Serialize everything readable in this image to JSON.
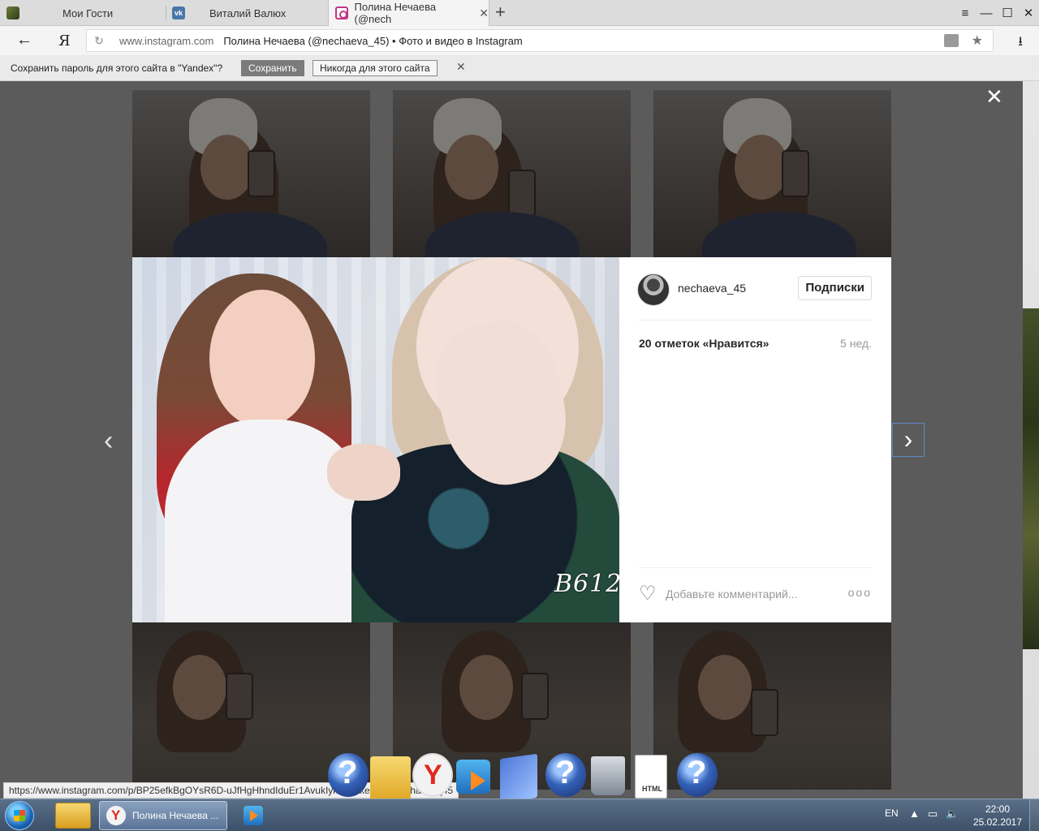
{
  "tabs": [
    {
      "label": "Мои Гости",
      "favicon": "apps-icon"
    },
    {
      "label": "Виталий Валюх",
      "favicon": "vk-icon"
    },
    {
      "label": "Полина Нечаева (@nech",
      "favicon": "instagram-icon",
      "active": true
    }
  ],
  "window_controls": {
    "menu": "≡",
    "minimize": "—",
    "maximize": "☐",
    "close": "✕"
  },
  "address": {
    "domain": "www.instagram.com",
    "page_title": "Полина Нечаева (@nechaeva_45) • Фото и видео в Instagram",
    "back_icon": "←",
    "logo": "Я"
  },
  "password_bar": {
    "message": "Сохранить пароль для этого сайта в \"Yandex\"?",
    "save": "Сохранить",
    "never": "Никогда для этого сайта",
    "close": "✕"
  },
  "post": {
    "username": "nechaeva_45",
    "follow_button": "Подписки",
    "likes": "20 отметок «Нравится»",
    "time_ago": "5 нед.",
    "comment_placeholder": "Добавьте комментарий...",
    "more": "ooo",
    "watermark": "B612"
  },
  "overlay": {
    "close": "✕",
    "prev": "‹",
    "next": "›"
  },
  "status_url": "https://www.instagram.com/p/BP25efkBgOYsR6D-uJfHgHhndIduEr1AvukIyk0/?taken-by=nechaeva_45",
  "taskbar": {
    "active_task": "Полина Нечаева ...",
    "language": "EN",
    "time": "22:00",
    "date": "25.02.2017"
  },
  "colors": {
    "instagram_pink": "#c13584",
    "taskbar": "#3c5068",
    "overlay": "#5b5b5b"
  }
}
